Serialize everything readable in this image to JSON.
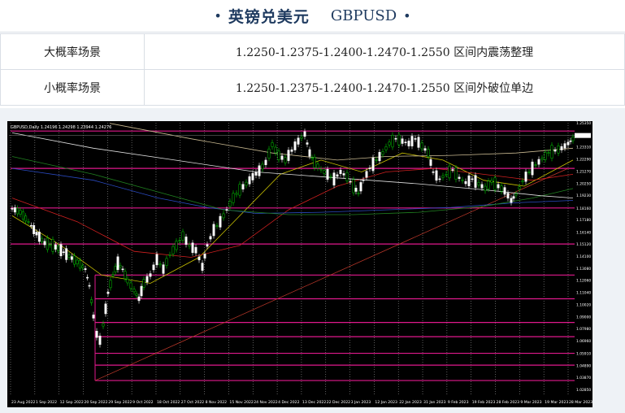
{
  "header": {
    "title_cn": "英镑兑美元",
    "title_en": "GBPUSD",
    "bullet": "•"
  },
  "table": {
    "rows": [
      {
        "label": "大概率场景",
        "value": "1.2250-1.2375-1.2400-1.2470-1.2550 区间内震荡整理"
      },
      {
        "label": "小概率场景",
        "value": "1.2250-1.2375-1.2400-1.2470-1.2550 区间外破位单边"
      }
    ]
  },
  "chart": {
    "symbol_label": "GBPUSD,Daily  1.24196  1.24298  1.23944  1.24276",
    "colors": {
      "background": "#000000",
      "bull": "#00cc00",
      "bear": "#ffffff",
      "level": "#e0198c",
      "grid": "#9a9a9a"
    },
    "price_labels": [
      "1.25350",
      "1.24276",
      "1.23310",
      "1.22290",
      "1.21270",
      "1.20250",
      "1.19230",
      "1.18160",
      "1.17180",
      "1.16140",
      "1.15120",
      "1.14100",
      "1.13080",
      "1.12060",
      "1.11040",
      "1.10020",
      "1.09000",
      "1.07980",
      "1.06960",
      "1.05910",
      "1.04890",
      "1.03870",
      "1.02850"
    ],
    "date_labels": [
      "23 Aug 2022",
      "1 Sep 2022",
      "12 Sep 2022",
      "20 Sep 2022",
      "29 Sep 2022",
      "9 Oct 2022",
      "18 Oct 2022",
      "27 Oct 2022",
      "8 Nov 2022",
      "15 Nov 2022",
      "24 Nov 2022",
      "4 Dec 2022",
      "13 Dec 2022",
      "22 Dec 2022",
      "3 Jan 2023",
      "12 Jan 2023",
      "22 Jan 2023",
      "31 Jan 2023",
      "9 Feb 2023",
      "19 Feb 2023",
      "28 Feb 2023",
      "9 Mar 2023",
      "19 Mar 2023",
      "28 Mar 2023"
    ]
  }
}
